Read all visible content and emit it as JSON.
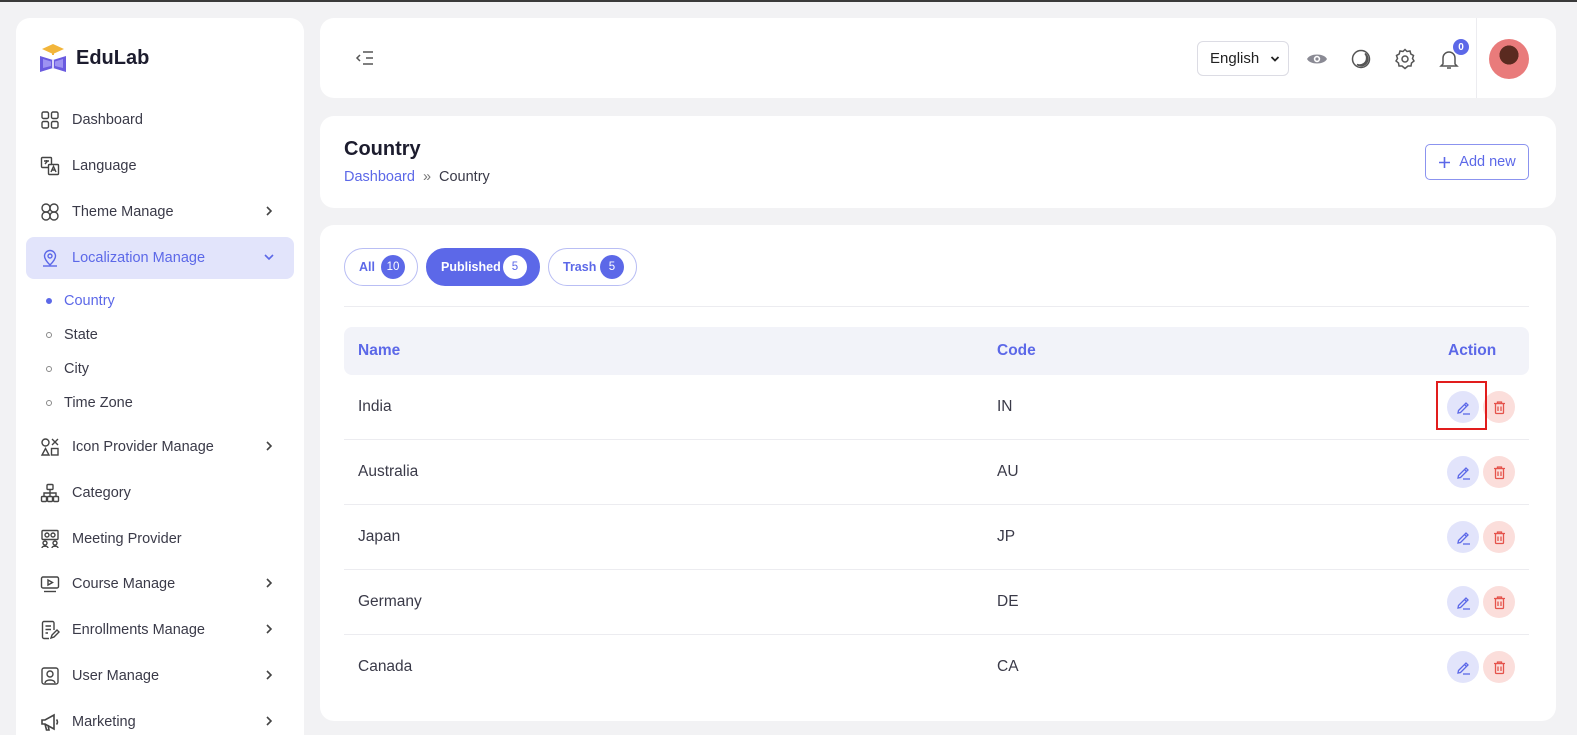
{
  "brand": {
    "name": "EduLab"
  },
  "sidebar": {
    "items": [
      {
        "label": "Dashboard",
        "icon": "grid-icon",
        "has_children": false
      },
      {
        "label": "Language",
        "icon": "translate-icon",
        "has_children": false
      },
      {
        "label": "Theme Manage",
        "icon": "theme-icon",
        "has_children": true
      },
      {
        "label": "Localization Manage",
        "icon": "location-icon",
        "has_children": true,
        "expanded": true
      },
      {
        "label": "Icon Provider Manage",
        "icon": "shapes-icon",
        "has_children": true
      },
      {
        "label": "Category",
        "icon": "hierarchy-icon",
        "has_children": false
      },
      {
        "label": "Meeting Provider",
        "icon": "meeting-icon",
        "has_children": false
      },
      {
        "label": "Course Manage",
        "icon": "video-icon",
        "has_children": true
      },
      {
        "label": "Enrollments Manage",
        "icon": "document-edit-icon",
        "has_children": true
      },
      {
        "label": "User Manage",
        "icon": "user-icon",
        "has_children": true
      },
      {
        "label": "Marketing",
        "icon": "megaphone-icon",
        "has_children": true
      }
    ],
    "sub_items": [
      {
        "label": "Country",
        "active": true
      },
      {
        "label": "State",
        "active": false
      },
      {
        "label": "City",
        "active": false
      },
      {
        "label": "Time Zone",
        "active": false
      }
    ]
  },
  "header": {
    "language": "English",
    "notification_count": "0"
  },
  "page": {
    "title": "Country",
    "breadcrumb": {
      "home": "Dashboard",
      "separator": "»",
      "current": "Country"
    },
    "add_label": "Add new"
  },
  "tabs": [
    {
      "label": "All",
      "count": "10",
      "active": false
    },
    {
      "label": "Published",
      "count": "5",
      "active": true
    },
    {
      "label": "Trash",
      "count": "5",
      "active": false
    }
  ],
  "table": {
    "columns": {
      "name": "Name",
      "code": "Code",
      "action": "Action"
    },
    "rows": [
      {
        "name": "India",
        "code": "IN"
      },
      {
        "name": "Australia",
        "code": "AU"
      },
      {
        "name": "Japan",
        "code": "JP"
      },
      {
        "name": "Germany",
        "code": "DE"
      },
      {
        "name": "Canada",
        "code": "CA"
      }
    ]
  },
  "colors": {
    "accent": "#5c68e8",
    "danger": "#e5534b",
    "highlight": "#e11d1d"
  }
}
